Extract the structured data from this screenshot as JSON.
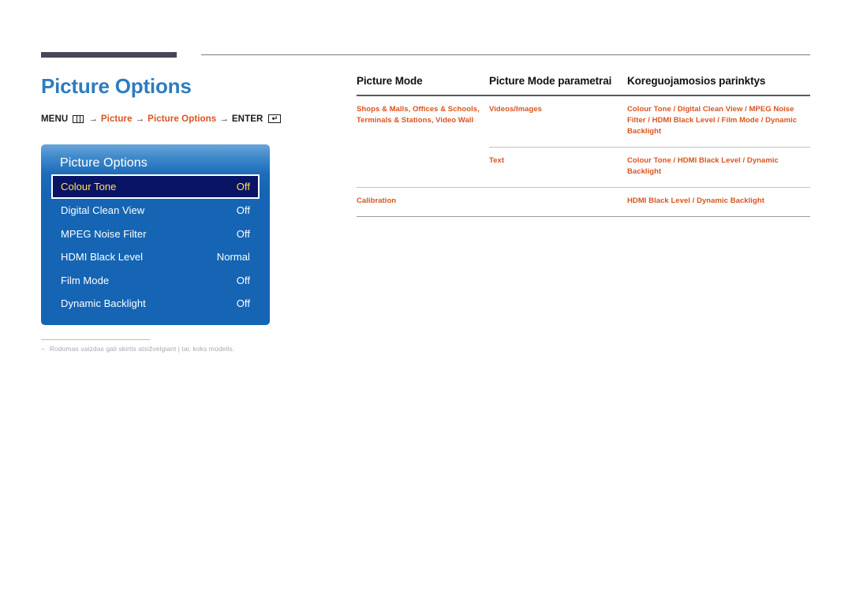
{
  "page": {
    "title": "Picture Options",
    "breadcrumb": {
      "menu_label": "MENU",
      "menu_icon": "menu-grid-icon",
      "arrow": "→",
      "step1": "Picture",
      "step2": "Picture Options",
      "enter_label": "ENTER",
      "enter_icon": "enter-return-icon"
    },
    "footnote": {
      "dash": "–",
      "text": "Rodomas vaizdas gali skirtis atsižvelgiant į tai, koks modelis."
    }
  },
  "osd": {
    "title": "Picture Options",
    "rows": [
      {
        "label": "Colour Tone",
        "value": "Off",
        "selected": true
      },
      {
        "label": "Digital Clean View",
        "value": "Off",
        "selected": false
      },
      {
        "label": "MPEG Noise Filter",
        "value": "Off",
        "selected": false
      },
      {
        "label": "HDMI Black Level",
        "value": "Normal",
        "selected": false
      },
      {
        "label": "Film Mode",
        "value": "Off",
        "selected": false
      },
      {
        "label": "Dynamic Backlight",
        "value": "Off",
        "selected": false
      }
    ]
  },
  "table": {
    "headers": {
      "col1": "Picture Mode",
      "col2": "Picture Mode parametrai",
      "col3": "Koreguojamosios parinktys"
    },
    "rows": [
      {
        "mode": "Shops & Malls, Offices & Schools, Terminals & Stations, Video Wall",
        "params": "Videos/Images",
        "options": "Colour Tone / Digital Clean View / MPEG Noise Filter / HDMI Black Level / Film Mode / Dynamic Backlight"
      },
      {
        "mode": "",
        "params": "Text",
        "options": "Colour Tone / HDMI Black Level / Dynamic Backlight"
      },
      {
        "mode": "Calibration",
        "params": "",
        "options": "HDMI Black Level / Dynamic Backlight"
      }
    ]
  },
  "colors": {
    "title_blue": "#2E7CBF",
    "accent_orange": "#D9541E",
    "osd_blue": "#1565B4",
    "osd_selected_bg": "#0A1464",
    "osd_selected_text": "#FFE14D",
    "rule_dark": "#464655"
  }
}
